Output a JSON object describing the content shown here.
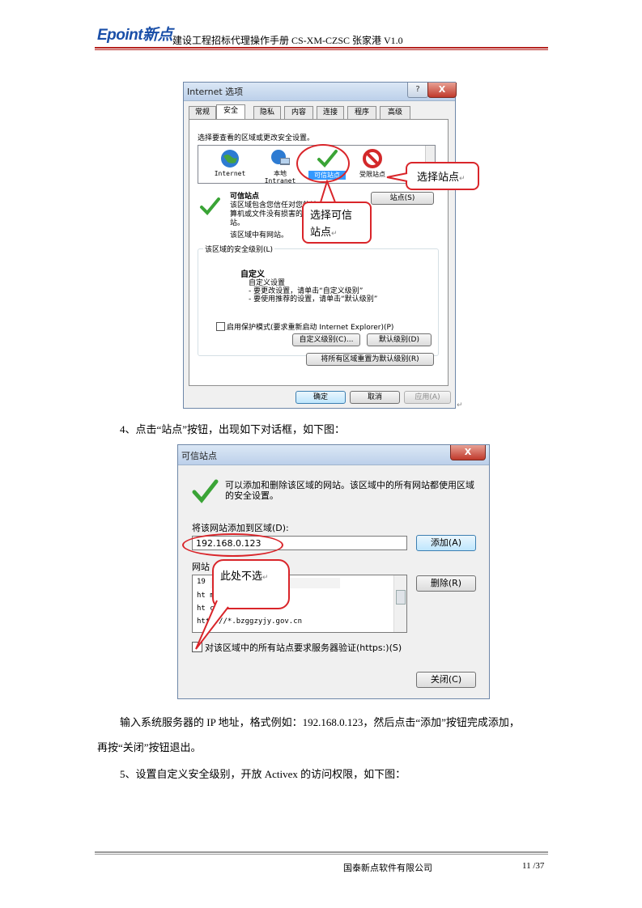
{
  "header": {
    "logo": "Epoint新点",
    "title": "建设工程招标代理操作手册 CS-XM-CZSC 张家港 V1.0"
  },
  "dialog1": {
    "title": "Internet 选项",
    "help": "?",
    "close": "X",
    "tabs": [
      "常规",
      "安全",
      "隐私",
      "内容",
      "连接",
      "程序",
      "高级"
    ],
    "prompt": "选择要查看的区域或更改安全设置。",
    "zones": [
      {
        "label": "Internet",
        "icon": "globe-icon"
      },
      {
        "label": "本地\nIntranet",
        "icon": "intranet-icon"
      },
      {
        "label": "可信站点",
        "icon": "checkmark-icon"
      },
      {
        "label": "受限站点",
        "icon": "restricted-icon"
      }
    ],
    "zone_heading": "可信站点",
    "zone_desc": "该区域包含您信任对您的计算机或文件没有损害的网站。",
    "zone_has_sites": "该区域中有网站。",
    "sites_button": "站点(S)",
    "level_group": "该区域的安全级别(L)",
    "custom_title": "自定义",
    "custom_lines": [
      "自定义设置",
      "- 要更改设置，请单击“自定义级别”",
      "- 要使用推荐的设置，请单击“默认级别”"
    ],
    "protected_mode": "启用保护模式(要求重新启动 Internet Explorer)(P)",
    "custom_level_button": "自定义级别(C)...",
    "default_level_button": "默认级别(D)",
    "reset_all_button": "将所有区域重置为默认级别(R)",
    "ok_button": "确定",
    "cancel_button": "取消",
    "apply_button": "应用(A)"
  },
  "callouts": {
    "select_site": "选择站点",
    "select_trusted_1": "选择可信",
    "select_trusted_2": "站点",
    "not_selected": "此处不选",
    "return_mark": "↵"
  },
  "para1": "4、点击“站点”按钮，出现如下对话框，如下图：",
  "dialog2": {
    "title": "可信站点",
    "close": "X",
    "info": "可以添加和删除该区域的网站。该区域中的所有网站都使用区域的安全设置。",
    "add_label": "将该网站添加到区域(D):",
    "add_value": "192.168.0.123",
    "add_button": "添加(A)",
    "sites_label": "网站",
    "sites": [
      "19",
      "ht              m",
      "ht              com",
      "http://*.bzggzyjy.gov.cn"
    ],
    "remove_button": "删除(R)",
    "https_check": "对该区域中的所有站点要求服务器验证(https:)(S)",
    "close_button": "关闭(C)"
  },
  "para2a": "输入系统服务器的 IP 地址，格式例如：192.168.0.123，然后点击“添加”按钮完成添加，",
  "para2b": "再按“关闭”按钮退出。",
  "para3": "5、设置自定义安全级别，开放 Activex 的访问权限，如下图：",
  "footer": {
    "company": "国泰新点软件有限公司",
    "page": "11 /37"
  },
  "colors": {
    "accent_red": "#d9252a",
    "logo_blue": "#1a4fa8",
    "check_green": "#3aa436"
  }
}
